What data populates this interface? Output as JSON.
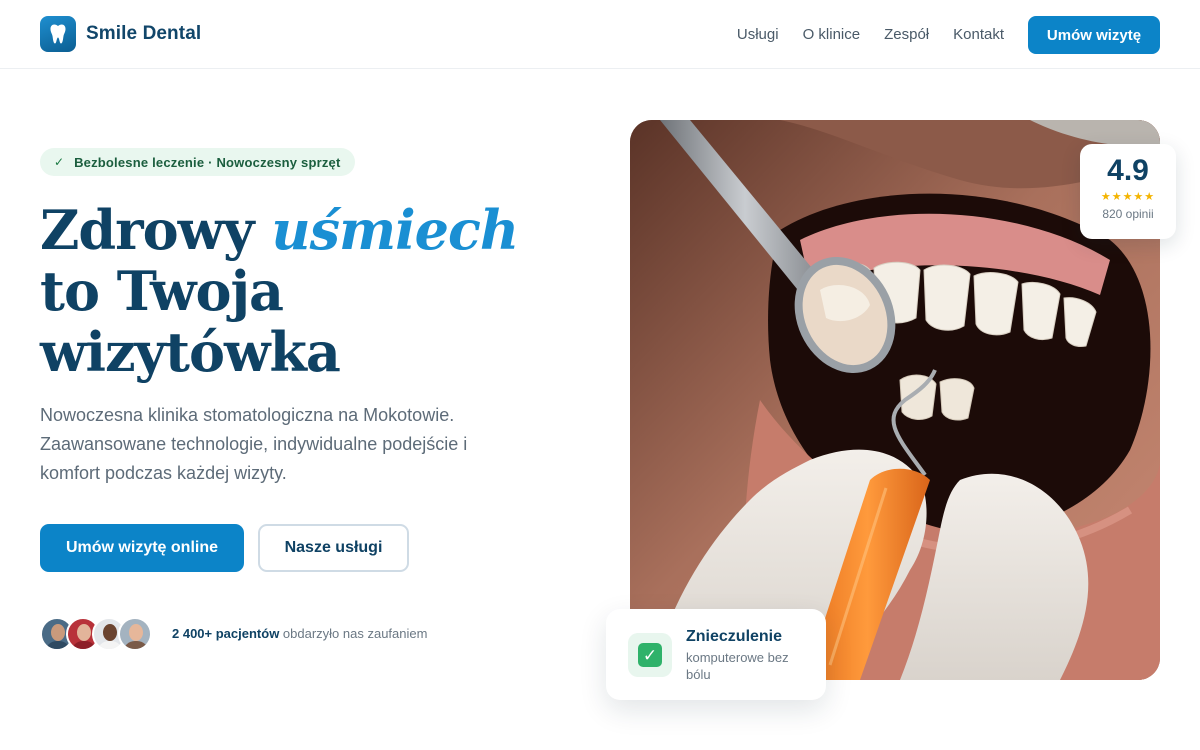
{
  "brand": {
    "name": "Smile Dental",
    "logo_icon": "tooth-icon"
  },
  "nav": {
    "links": [
      {
        "label": "Usługi"
      },
      {
        "label": "O klinice"
      },
      {
        "label": "Zespół"
      },
      {
        "label": "Kontakt"
      }
    ],
    "cta_label": "Umów wizytę"
  },
  "hero": {
    "badge_check": "✓",
    "badge_text": "Bezbolesne leczenie · Nowoczesny sprzęt",
    "headline": {
      "part1": "Zdrowy ",
      "accent": "uśmiech",
      "line2": "to Twoja",
      "line3": "wizytówka"
    },
    "lead": "Nowoczesna klinika stomatologiczna na Mokotowie. Zaawansowane technologie, indywidualne podejście i komfort podczas każdej wizyty.",
    "primary_button": "Umów wizytę online",
    "secondary_button": "Nasze usługi",
    "trust": {
      "count": "2 400+ pacjentów",
      "text": " obdarzyło nas zaufaniem"
    }
  },
  "rating": {
    "value": "4.9",
    "stars": "★★★★★",
    "stars_count": 5,
    "count": "820 opinii"
  },
  "feature": {
    "icon": "check-mark-icon",
    "title": "Znieczulenie",
    "subtitle": "komputerowe bez bólu"
  },
  "colors": {
    "primary": "#0c84c8",
    "heading": "#0f4264",
    "accent": "#1a8fd3",
    "badge_bg": "#e9f7ef",
    "star": "#f4b400"
  }
}
